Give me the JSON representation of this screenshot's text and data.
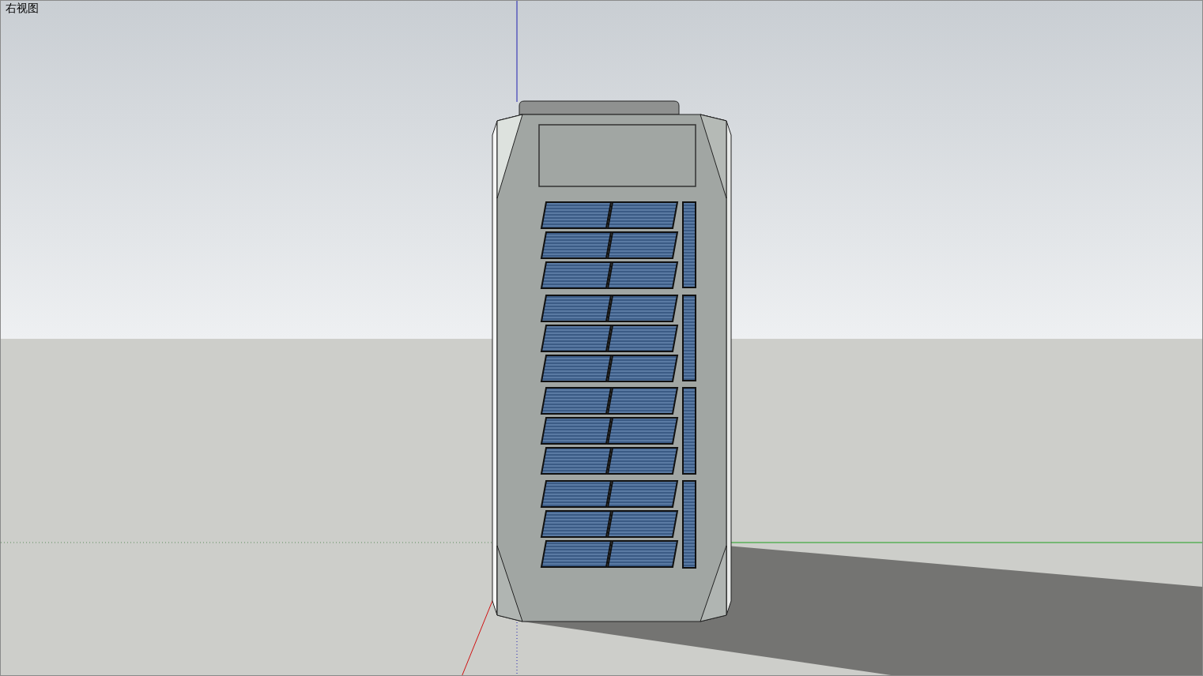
{
  "viewport": {
    "view_name": "右视图"
  }
}
